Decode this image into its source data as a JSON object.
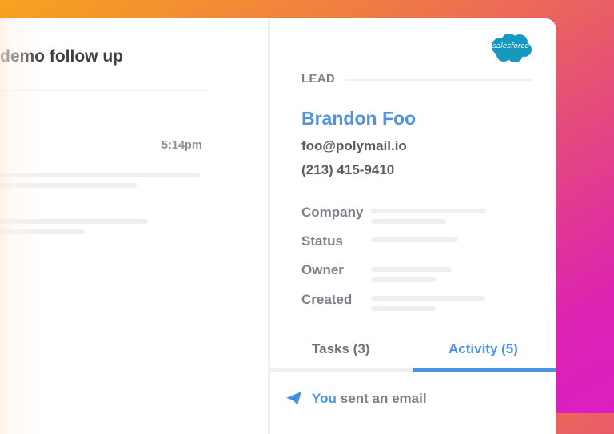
{
  "email_thread": {
    "subject": "demo follow up",
    "message_time": "5:14pm"
  },
  "crm_panel": {
    "integration": "salesforce",
    "logo_text": "salesforce",
    "record_type": "LEAD",
    "contact": {
      "name": "Brandon Foo",
      "email": "foo@polymail.io",
      "phone": "(213) 415-9410"
    },
    "fields": [
      {
        "label": "Company"
      },
      {
        "label": "Status"
      },
      {
        "label": "Owner"
      },
      {
        "label": "Created"
      }
    ],
    "tabs": [
      {
        "label": "Tasks (3)",
        "active": false
      },
      {
        "label": "Activity (5)",
        "active": true
      }
    ],
    "activity": [
      {
        "icon": "paper-plane-icon",
        "actor": "You",
        "text": "sent an email"
      }
    ]
  },
  "colors": {
    "accent": "#4c94e3",
    "salesforce_blue": "#1798c1",
    "gradient_start": "#f7a31f",
    "gradient_end": "#d91fc2"
  }
}
